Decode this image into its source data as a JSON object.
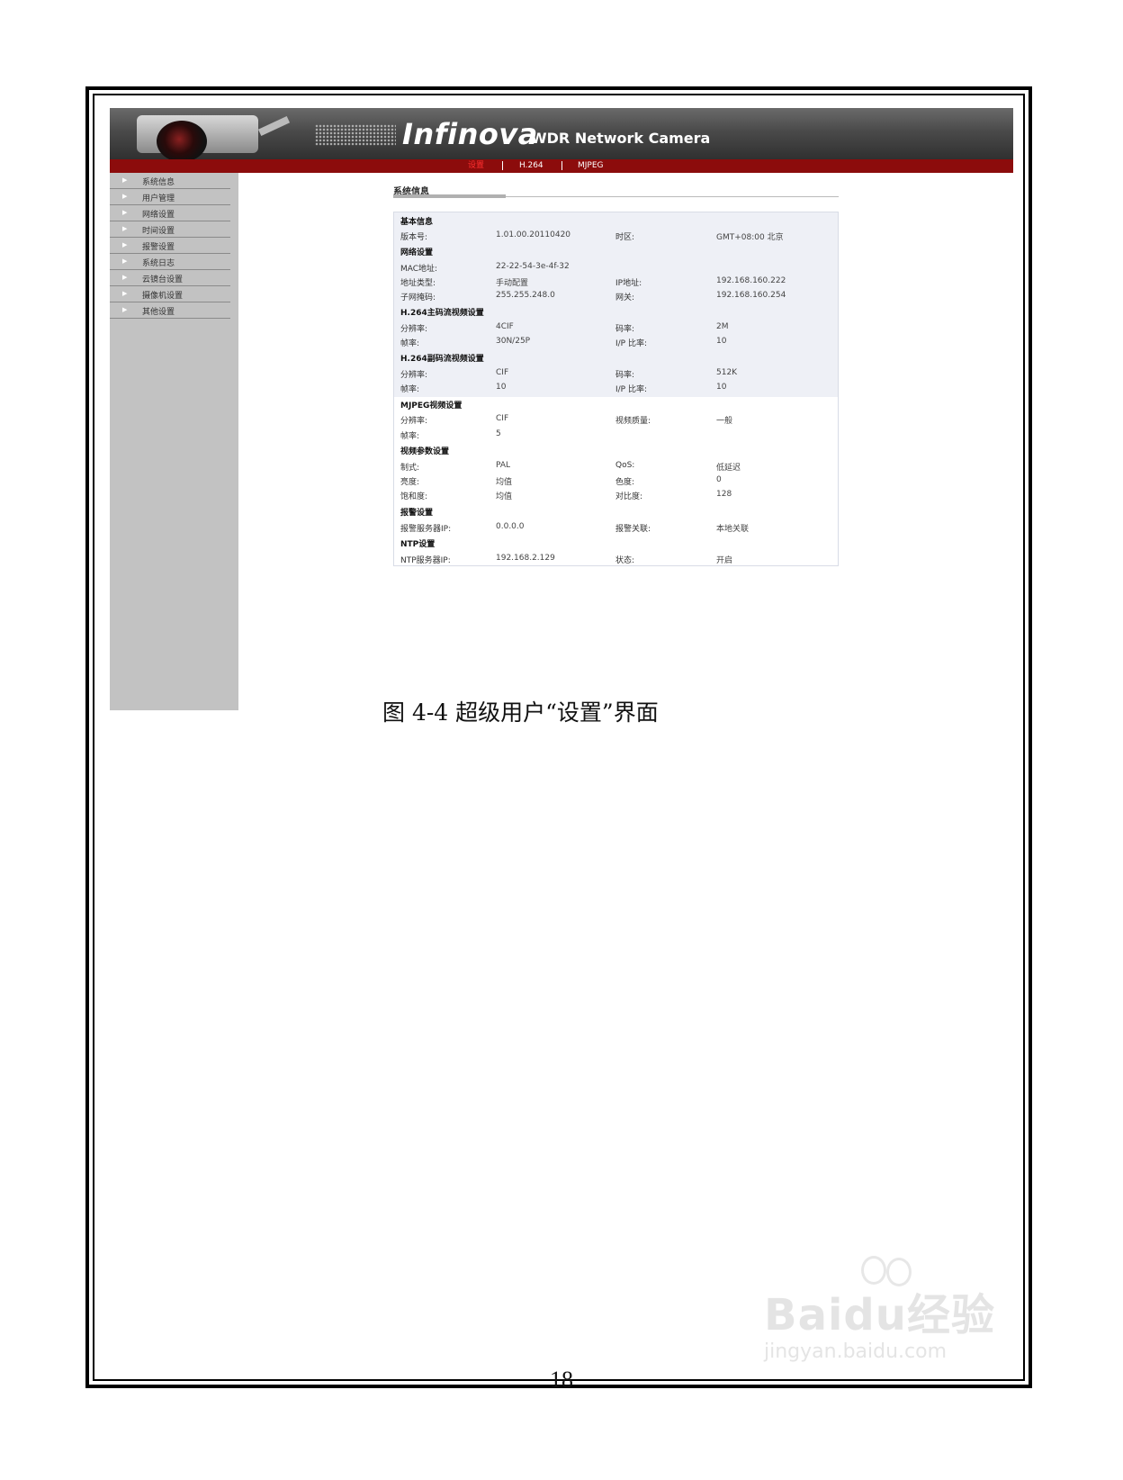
{
  "banner": {
    "brand": "Infinova",
    "subtitle": "WDR Network Camera"
  },
  "nav": {
    "items": [
      "设置",
      "H.264",
      "MJPEG"
    ],
    "active_color": "#ff3030",
    "bar_color": "#8c0c0c"
  },
  "sidebar": {
    "items": [
      "系统信息",
      "用户管理",
      "网络设置",
      "时间设置",
      "报警设置",
      "系统日志",
      "云镜台设置",
      "摄像机设置",
      "其他设置"
    ]
  },
  "content": {
    "title": "系统信息",
    "sections": {
      "basic": {
        "heading": "基本信息",
        "firmware_label": "版本号:",
        "firmware_value": "1.01.00.20110420",
        "timezone_label": "时区:",
        "timezone_value": "GMT+08:00 北京"
      },
      "network": {
        "heading": "网络设置",
        "mac_label": "MAC地址:",
        "mac_value": "22-22-54-3e-4f-32",
        "addr_type_label": "地址类型:",
        "addr_type_value": "手动配置",
        "ip_label": "IP地址:",
        "ip_value": "192.168.160.222",
        "mask_label": "子网掩码:",
        "mask_value": "255.255.248.0",
        "gateway_label": "网关:",
        "gateway_value": "192.168.160.254"
      },
      "h264_main": {
        "heading": "H.264主码流视频设置",
        "res_label": "分辨率:",
        "res_value": "4CIF",
        "bitrate_label": "码率:",
        "bitrate_value": "2M",
        "fps_label": "帧率:",
        "fps_value": "30N/25P",
        "ip_ratio_label": "I/P 比率:",
        "ip_ratio_value": "10"
      },
      "h264_sub": {
        "heading": "H.264副码流视频设置",
        "res_label": "分辨率:",
        "res_value": "CIF",
        "bitrate_label": "码率:",
        "bitrate_value": "512K",
        "fps_label": "帧率:",
        "fps_value": "10",
        "ip_ratio_label": "I/P 比率:",
        "ip_ratio_value": "10"
      },
      "mjpeg": {
        "heading": "MJPEG视频设置",
        "res_label": "分辨率:",
        "res_value": "CIF",
        "quality_label": "视频质量:",
        "quality_value": "一般",
        "fps_label": "帧率:",
        "fps_value": "5"
      },
      "video_params": {
        "heading": "视频参数设置",
        "format_label": "制式:",
        "format_value": "PAL",
        "qos_label": "QoS:",
        "qos_value": "低延迟",
        "brightness_label": "亮度:",
        "brightness_value": "均值",
        "hue_label": "色度:",
        "hue_value": "0",
        "saturation_label": "饱和度:",
        "saturation_value": "均值",
        "contrast_label": "对比度:",
        "contrast_value": "128"
      },
      "alarm": {
        "heading": "报警设置",
        "server_label": "报警服务器IP:",
        "server_value": "0.0.0.0",
        "link_label": "报警关联:",
        "link_value": "本地关联"
      },
      "ntp": {
        "heading": "NTP设置",
        "server_label": "NTP服务器IP:",
        "server_value": "192.168.2.129",
        "status_label": "状态:",
        "status_value": "开启"
      }
    }
  },
  "caption": "图 4-4  超级用户“设置”界面",
  "page_number": "18",
  "watermark": {
    "logo": "Baidu经验",
    "url": "jingyan.baidu.com"
  }
}
